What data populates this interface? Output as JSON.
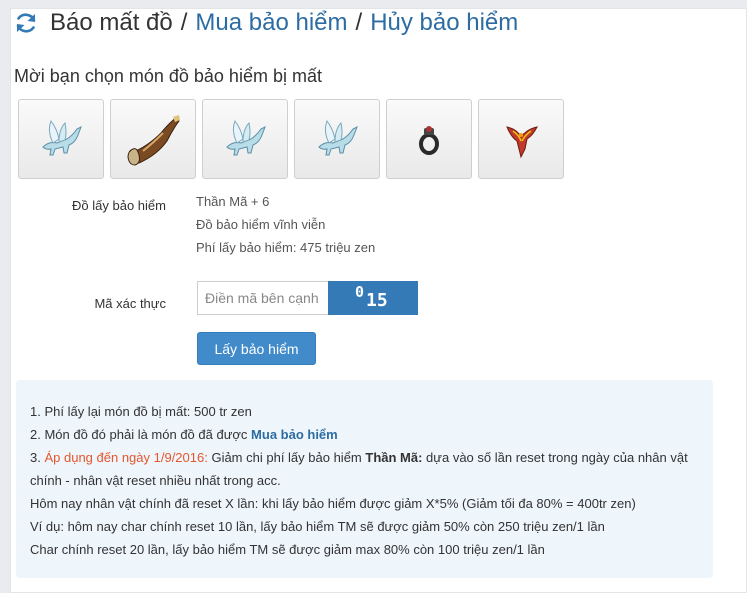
{
  "header": {
    "title_plain": "Báo mất đồ",
    "sep1": "/",
    "link1": "Mua bảo hiểm",
    "sep2": "/",
    "link2": "Hủy bảo hiểm"
  },
  "subtitle": "Mời bạn chọn món đồ bảo hiểm bị mất",
  "items": [
    {
      "icon": "pegasus-icon"
    },
    {
      "icon": "horn-icon"
    },
    {
      "icon": "pegasus-icon"
    },
    {
      "icon": "pegasus-icon"
    },
    {
      "icon": "ring-icon"
    },
    {
      "icon": "phoenix-icon"
    }
  ],
  "selected_item": {
    "label": "Đồ lấy bảo hiểm",
    "name": "Thần Mã + 6",
    "type": "Đồ bảo hiểm vĩnh viễn",
    "fee": "Phí lấy bảo hiểm: 475 triệu zen"
  },
  "captcha": {
    "label": "Mã xác thực",
    "placeholder": "Điền mã bên cạnh",
    "code_char1": "0",
    "code_char2": "15"
  },
  "submit_label": "Lấy bảo hiểm",
  "notes": {
    "line1": "1. Phí lấy lại món đồ bị mất: 500 tr zen",
    "line2_prefix": "2. Món đồ đó phải là món đồ đã được ",
    "line2_link": "Mua bảo hiểm",
    "line3_number": "3. ",
    "line3_red": "Áp dụng đến ngày 1/9/2016:",
    "line3_text": " Giảm chi phí lấy bảo hiểm ",
    "line3_bold": "Thần Mã:",
    "line3_rest": " dựa vào số lần reset trong ngày của nhân vật chính - nhân vật reset nhiều nhất trong acc.",
    "line4": "Hôm nay nhân vật chính đã reset X lần: khi lấy bảo hiểm được giảm X*5% (Giảm tối đa 80% = 400tr zen)",
    "line5": "Ví dụ: hôm nay char chính reset 10 lần, lấy bảo hiểm TM sẽ được giảm 50% còn 250 triệu zen/1 lần",
    "line6": "Char chính reset 20 lần, lấy bảo hiểm TM sẽ được giảm max 80% còn 100 triệu zen/1 lần"
  },
  "colors": {
    "link": "#2d6ca2",
    "button": "#428bca",
    "captcha_bg": "#337ab7",
    "note_bg": "#eef5fb",
    "warning": "#e4572e"
  }
}
